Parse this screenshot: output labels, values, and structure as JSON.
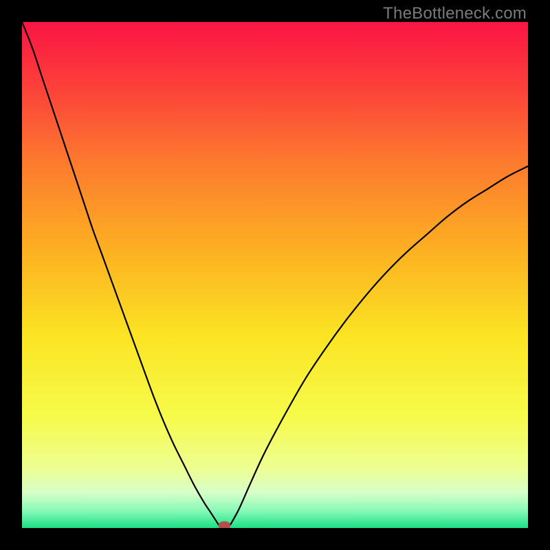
{
  "chart_data": {
    "type": "line",
    "title": "",
    "xlabel": "",
    "ylabel": "",
    "xlim": [
      0,
      736
    ],
    "ylim": [
      0,
      736
    ],
    "curve_description": "Asymmetric V-shaped bottleneck curve. Left branch descends steeply from top-left, right branch ascends more gradually toward right edge at about 70% height. Minimum (bottleneck point) near x≈0.40 of width at y≈0.",
    "x": [
      0.0,
      0.02,
      0.04,
      0.06,
      0.08,
      0.1,
      0.12,
      0.14,
      0.16,
      0.18,
      0.2,
      0.22,
      0.24,
      0.26,
      0.28,
      0.3,
      0.32,
      0.34,
      0.36,
      0.37,
      0.385,
      0.39,
      0.4,
      0.41,
      0.415,
      0.43,
      0.45,
      0.48,
      0.52,
      0.56,
      0.6,
      0.64,
      0.68,
      0.72,
      0.76,
      0.8,
      0.84,
      0.88,
      0.92,
      0.96,
      1.0
    ],
    "y": [
      1.0,
      0.95,
      0.89,
      0.83,
      0.77,
      0.71,
      0.65,
      0.59,
      0.535,
      0.48,
      0.425,
      0.37,
      0.315,
      0.26,
      0.21,
      0.165,
      0.125,
      0.085,
      0.05,
      0.035,
      0.012,
      0.005,
      0.0,
      0.005,
      0.012,
      0.04,
      0.085,
      0.15,
      0.225,
      0.295,
      0.355,
      0.41,
      0.46,
      0.505,
      0.545,
      0.58,
      0.615,
      0.645,
      0.67,
      0.695,
      0.715
    ],
    "min_marker": {
      "x": 0.4,
      "y": 0.005
    },
    "series": [
      {
        "name": "bottleneck-curve"
      }
    ]
  },
  "gradient_stops": [
    {
      "offset": 0.0,
      "color": "#fb1444"
    },
    {
      "offset": 0.12,
      "color": "#fc3d3a"
    },
    {
      "offset": 0.28,
      "color": "#fd7b2e"
    },
    {
      "offset": 0.45,
      "color": "#fdb022"
    },
    {
      "offset": 0.62,
      "color": "#fbe423"
    },
    {
      "offset": 0.78,
      "color": "#f6fb4a"
    },
    {
      "offset": 0.88,
      "color": "#eefe90"
    },
    {
      "offset": 0.93,
      "color": "#d7ffc8"
    },
    {
      "offset": 0.965,
      "color": "#8bf9b9"
    },
    {
      "offset": 1.0,
      "color": "#1be084"
    }
  ],
  "watermark": "TheBottleneck.com",
  "marker_color": "#b64c4c"
}
